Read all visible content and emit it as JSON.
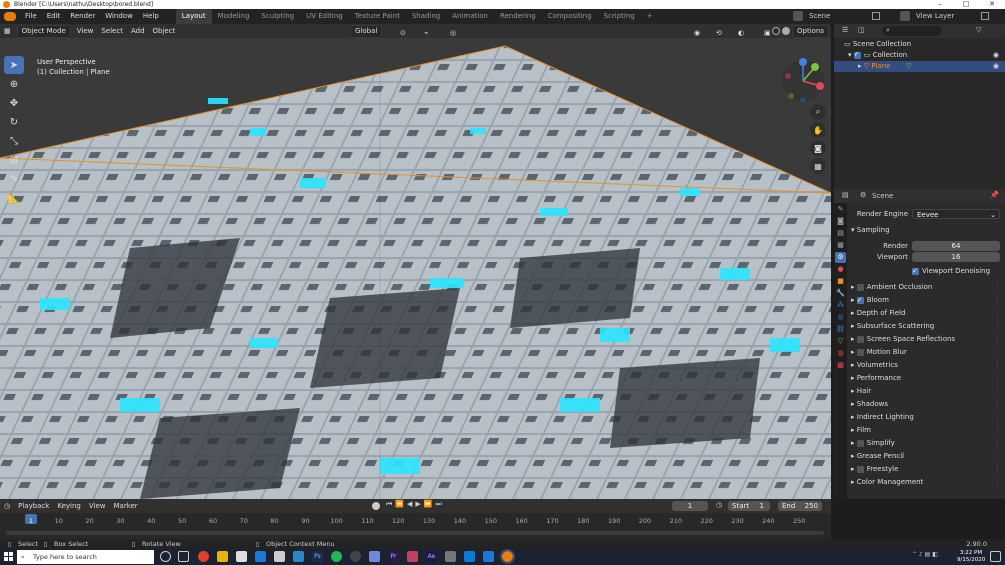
{
  "window": {
    "title": "Blender [C:\\Users\\nathu\\Desktop\\bored.blend]",
    "controls": [
      "–",
      "□",
      "✕"
    ]
  },
  "menu": [
    "File",
    "Edit",
    "Render",
    "Window",
    "Help"
  ],
  "workspaces": [
    "Layout",
    "Modeling",
    "Sculpting",
    "UV Editing",
    "Texture Paint",
    "Shading",
    "Animation",
    "Rendering",
    "Compositing",
    "Scripting"
  ],
  "active_workspace": "Layout",
  "scene_label": "Scene",
  "view_layer_label": "View Layer",
  "viewport_header": {
    "mode": "Object Mode",
    "items": [
      "View",
      "Select",
      "Add",
      "Object"
    ],
    "orientation": "Global",
    "options": "Options"
  },
  "viewport": {
    "perspective": "User Perspective",
    "collection": "(1) Collection | Plane"
  },
  "gizmo": {
    "axes": [
      "X",
      "Y",
      "Z"
    ]
  },
  "outliner": {
    "root": "Scene Collection",
    "collection": "Collection",
    "object": "Plane"
  },
  "properties": {
    "context": "Scene",
    "render_engine_label": "Render Engine",
    "render_engine": "Eevee",
    "sampling": {
      "title": "Sampling",
      "render_label": "Render",
      "render_value": "64",
      "viewport_label": "Viewport",
      "viewport_value": "16",
      "denoise_label": "Viewport Denoising"
    },
    "panels": [
      {
        "label": "Ambient Occlusion",
        "checkbox": true,
        "checked": false
      },
      {
        "label": "Bloom",
        "checkbox": true,
        "checked": true
      },
      {
        "label": "Depth of Field",
        "checkbox": false
      },
      {
        "label": "Subsurface Scattering",
        "checkbox": false
      },
      {
        "label": "Screen Space Reflections",
        "checkbox": true,
        "checked": false
      },
      {
        "label": "Motion Blur",
        "checkbox": true,
        "checked": false
      },
      {
        "label": "Volumetrics",
        "checkbox": false
      },
      {
        "label": "Performance",
        "checkbox": false
      },
      {
        "label": "Hair",
        "checkbox": false
      },
      {
        "label": "Shadows",
        "checkbox": false
      },
      {
        "label": "Indirect Lighting",
        "checkbox": false
      },
      {
        "label": "Film",
        "checkbox": false
      },
      {
        "label": "Simplify",
        "checkbox": true,
        "checked": false
      },
      {
        "label": "Grease Pencil",
        "checkbox": false
      },
      {
        "label": "Freestyle",
        "checkbox": true,
        "checked": false
      },
      {
        "label": "Color Management",
        "checkbox": false
      }
    ]
  },
  "timeline": {
    "menus": [
      "Playback",
      "Keying",
      "View",
      "Marker"
    ],
    "current_frame": "1",
    "start_label": "Start",
    "start": "1",
    "end_label": "End",
    "end": "250",
    "ticks": [
      "1",
      "10",
      "20",
      "30",
      "40",
      "50",
      "60",
      "70",
      "80",
      "90",
      "100",
      "110",
      "120",
      "130",
      "140",
      "150",
      "160",
      "170",
      "180",
      "190",
      "200",
      "210",
      "220",
      "230",
      "240",
      "250"
    ]
  },
  "statusbar": {
    "select": "Select",
    "box_select": "Box Select",
    "rotate": "Rotate View",
    "context_menu": "Object Context Menu",
    "version": "2.90.0"
  },
  "taskbar": {
    "search_placeholder": "Type here to search",
    "time": "3:22 PM",
    "date": "9/15/2020"
  },
  "colors": {
    "accent": "#4772b3",
    "glow": "#29e6ff",
    "selection_outline": "#e8902a"
  }
}
